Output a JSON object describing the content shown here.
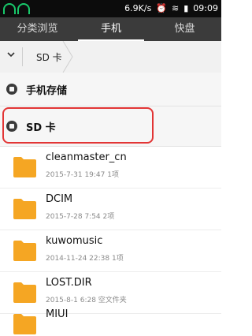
{
  "status_bar": {
    "speed": "6.9K/s",
    "time": "09:09"
  },
  "tabs": [
    {
      "label": "分类浏览"
    },
    {
      "label": "手机"
    },
    {
      "label": "快盘"
    }
  ],
  "breadcrumb": {
    "current": "SD 卡"
  },
  "storage": {
    "phone": "手机存储",
    "sd": "SD 卡"
  },
  "files": [
    {
      "name": "cleanmaster_cn",
      "meta": "2015-7-31 19:47  1项"
    },
    {
      "name": "DCIM",
      "meta": "2015-7-28 7:54  2项"
    },
    {
      "name": "kuwomusic",
      "meta": "2014-11-24 22:38  1项"
    },
    {
      "name": "LOST.DIR",
      "meta": "2015-8-1 6:28  空文件夹"
    },
    {
      "name": "MIUI",
      "meta": ""
    }
  ],
  "colors": {
    "accent_red": "#e23535",
    "folder": "#f5a623"
  }
}
